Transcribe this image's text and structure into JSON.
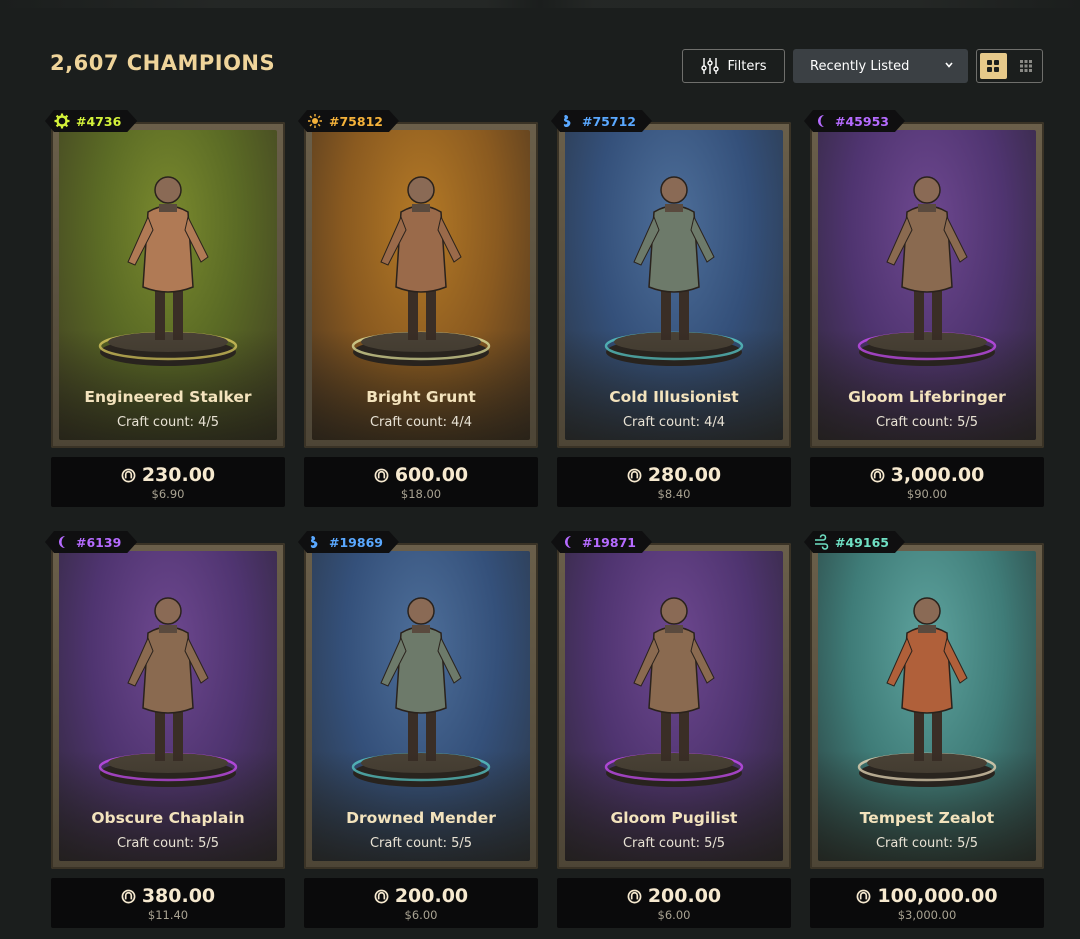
{
  "header": {
    "count": "2,607 CHAMPIONS",
    "filters_label": "Filters",
    "sort_selected": "Recently Listed"
  },
  "cards": [
    {
      "id": "#4736",
      "name": "Engineered Stalker",
      "craft": "Craft count: 4/5",
      "price": "230.00",
      "usd": "$6.90",
      "theme": "green",
      "tag_color": "#d4f23a",
      "glyph": "gear-icon"
    },
    {
      "id": "#75812",
      "name": "Bright Grunt",
      "craft": "Craft count: 4/4",
      "price": "600.00",
      "usd": "$18.00",
      "theme": "orange",
      "tag_color": "#f5b23a",
      "glyph": "sun-icon"
    },
    {
      "id": "#75712",
      "name": "Cold Illusionist",
      "craft": "Craft count: 4/4",
      "price": "280.00",
      "usd": "$8.40",
      "theme": "blue",
      "tag_color": "#5aa8ff",
      "glyph": "water-icon"
    },
    {
      "id": "#45953",
      "name": "Gloom Lifebringer",
      "craft": "Craft count: 5/5",
      "price": "3,000.00",
      "usd": "$90.00",
      "theme": "purple",
      "tag_color": "#b66bff",
      "glyph": "moon-icon"
    },
    {
      "id": "#6139",
      "name": "Obscure Chaplain",
      "craft": "Craft count: 5/5",
      "price": "380.00",
      "usd": "$11.40",
      "theme": "purple",
      "tag_color": "#b66bff",
      "glyph": "moon-icon"
    },
    {
      "id": "#19869",
      "name": "Drowned Mender",
      "craft": "Craft count: 5/5",
      "price": "200.00",
      "usd": "$6.00",
      "theme": "blue",
      "tag_color": "#5aa8ff",
      "glyph": "water-icon"
    },
    {
      "id": "#19871",
      "name": "Gloom Pugilist",
      "craft": "Craft count: 5/5",
      "price": "200.00",
      "usd": "$6.00",
      "theme": "purple",
      "tag_color": "#b66bff",
      "glyph": "moon-icon"
    },
    {
      "id": "#49165",
      "name": "Tempest Zealot",
      "craft": "Craft count: 5/5",
      "price": "100,000.00",
      "usd": "$3,000.00",
      "theme": "teal",
      "tag_color": "#6fe0c4",
      "glyph": "wind-icon"
    }
  ]
}
